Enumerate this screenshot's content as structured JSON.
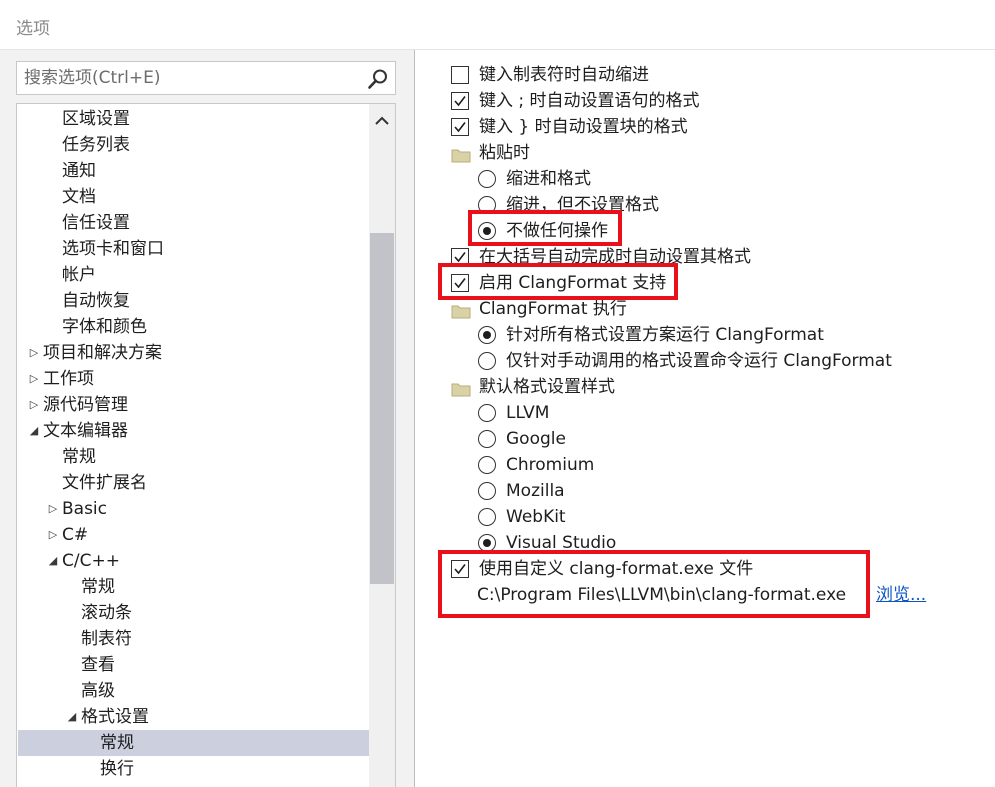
{
  "window": {
    "title": "选项"
  },
  "search": {
    "placeholder": "搜索选项(Ctrl+E)"
  },
  "tree": [
    {
      "label": "区域设置",
      "indent": 1,
      "toggle": ""
    },
    {
      "label": "任务列表",
      "indent": 1,
      "toggle": ""
    },
    {
      "label": "通知",
      "indent": 1,
      "toggle": ""
    },
    {
      "label": "文档",
      "indent": 1,
      "toggle": ""
    },
    {
      "label": "信任设置",
      "indent": 1,
      "toggle": ""
    },
    {
      "label": "选项卡和窗口",
      "indent": 1,
      "toggle": ""
    },
    {
      "label": "帐户",
      "indent": 1,
      "toggle": ""
    },
    {
      "label": "自动恢复",
      "indent": 1,
      "toggle": ""
    },
    {
      "label": "字体和颜色",
      "indent": 1,
      "toggle": ""
    },
    {
      "label": "项目和解决方案",
      "indent": 0,
      "toggle": "collapsed"
    },
    {
      "label": "工作项",
      "indent": 0,
      "toggle": "collapsed"
    },
    {
      "label": "源代码管理",
      "indent": 0,
      "toggle": "collapsed"
    },
    {
      "label": "文本编辑器",
      "indent": 0,
      "toggle": "expanded"
    },
    {
      "label": "常规",
      "indent": 1,
      "toggle": ""
    },
    {
      "label": "文件扩展名",
      "indent": 1,
      "toggle": ""
    },
    {
      "label": "Basic",
      "indent": 1,
      "toggle": "collapsed"
    },
    {
      "label": "C#",
      "indent": 1,
      "toggle": "collapsed"
    },
    {
      "label": "C/C++",
      "indent": 1,
      "toggle": "expanded"
    },
    {
      "label": "常规",
      "indent": 2,
      "toggle": ""
    },
    {
      "label": "滚动条",
      "indent": 2,
      "toggle": ""
    },
    {
      "label": "制表符",
      "indent": 2,
      "toggle": ""
    },
    {
      "label": "查看",
      "indent": 2,
      "toggle": ""
    },
    {
      "label": "高级",
      "indent": 2,
      "toggle": ""
    },
    {
      "label": "格式设置",
      "indent": 2,
      "toggle": "expanded"
    },
    {
      "label": "常规",
      "indent": 3,
      "toggle": "",
      "selected": true
    },
    {
      "label": "换行",
      "indent": 3,
      "toggle": ""
    }
  ],
  "options": {
    "auto_indent_tab": {
      "label": "键入制表符时自动缩进",
      "checked": false
    },
    "format_stmt_semicolon": {
      "label": "键入 ; 时自动设置语句的格式",
      "checked": true
    },
    "format_block_brace": {
      "label": "键入 } 时自动设置块的格式",
      "checked": true
    },
    "paste_group": {
      "label": "粘贴时"
    },
    "paste_indent_format": {
      "label": "缩进和格式",
      "selected": false
    },
    "paste_indent_only": {
      "label": "缩进，但不设置格式",
      "selected": false
    },
    "paste_nothing": {
      "label": "不做任何操作",
      "selected": true
    },
    "brace_completion": {
      "label": "在大括号自动完成时自动设置其格式",
      "checked": true
    },
    "enable_clangformat": {
      "label": "启用 ClangFormat 支持",
      "checked": true
    },
    "clangformat_exec_group": {
      "label": "ClangFormat 执行"
    },
    "run_all": {
      "label": "针对所有格式设置方案运行 ClangFormat",
      "selected": true
    },
    "run_manual": {
      "label": "仅针对手动调用的格式设置命令运行 ClangFormat",
      "selected": false
    },
    "style_group": {
      "label": "默认格式设置样式"
    },
    "styles": [
      {
        "label": "LLVM",
        "selected": false
      },
      {
        "label": "Google",
        "selected": false
      },
      {
        "label": "Chromium",
        "selected": false
      },
      {
        "label": "Mozilla",
        "selected": false
      },
      {
        "label": "WebKit",
        "selected": false
      },
      {
        "label": "Visual Studio",
        "selected": true
      }
    ],
    "custom_exe": {
      "label": "使用自定义 clang-format.exe 文件",
      "checked": true
    },
    "custom_exe_path": "C:\\Program Files\\LLVM\\bin\\clang-format.exe",
    "browse_label": "浏览..."
  },
  "colors": {
    "highlight": "#e8101a",
    "selection": "#cbcfde",
    "link": "#0b55c4"
  }
}
